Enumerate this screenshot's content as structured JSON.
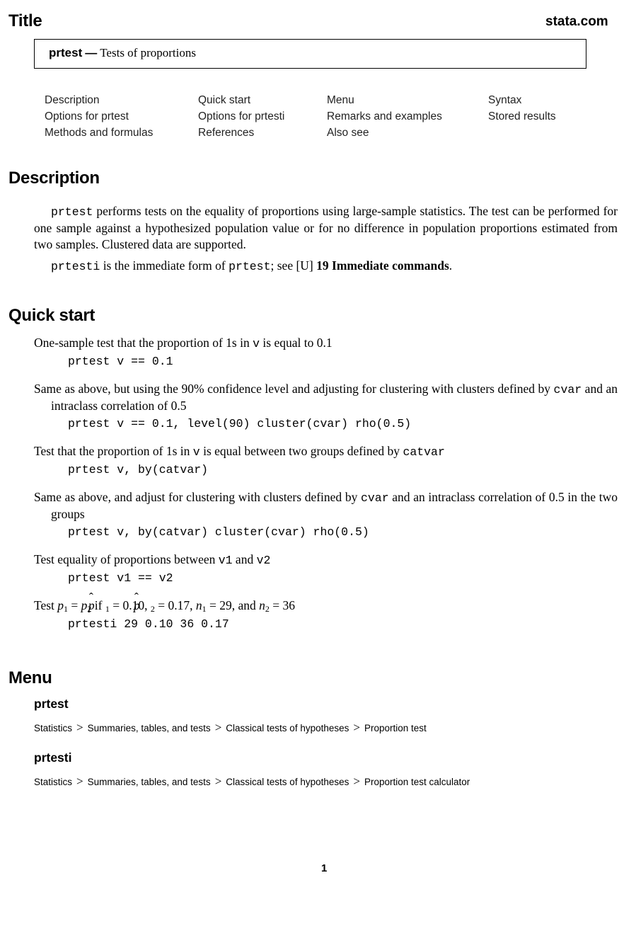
{
  "header": {
    "section_label": "Title",
    "brand": "stata.com"
  },
  "title_box": {
    "command": "prtest",
    "dash": "—",
    "description": "Tests of proportions"
  },
  "toc": {
    "columns": [
      [
        "Description",
        "Options for prtest",
        "Methods and formulas"
      ],
      [
        "Quick start",
        "Options for prtesti",
        "References"
      ],
      [
        "Menu",
        "Remarks and examples",
        "Also see"
      ],
      [
        "Syntax",
        "Stored results"
      ]
    ]
  },
  "description": {
    "heading": "Description",
    "p1": {
      "code": "prtest",
      "text": " performs tests on the equality of proportions using large-sample statistics. The test can be performed for one sample against a hypothesized population value or for no difference in population proportions estimated from two samples. Clustered data are supported."
    },
    "p2": {
      "code1": "prtesti",
      "text1": " is the immediate form of ",
      "code2": "prtest",
      "text2": "; see [U] ",
      "ref": "19 Immediate commands",
      "text3": "."
    }
  },
  "quick_start": {
    "heading": "Quick start",
    "items": [
      {
        "desc_parts": [
          "One-sample test that the proportion of 1s in ",
          "v",
          " is equal to 0.1"
        ],
        "command": "prtest v == 0.1"
      },
      {
        "desc_parts": [
          "Same as above, but using the 90% confidence level and adjusting for clustering with clusters defined by ",
          "cvar",
          " and an intraclass correlation of 0.5"
        ],
        "command": "prtest v == 0.1, level(90) cluster(cvar) rho(0.5)"
      },
      {
        "desc_parts": [
          "Test that the proportion of 1s in ",
          "v",
          " is equal between two groups defined by ",
          "catvar"
        ],
        "command": "prtest v, by(catvar)"
      },
      {
        "desc_parts": [
          "Same as above, and adjust for clustering with clusters defined by ",
          "cvar",
          " and an intraclass correlation of 0.5 in the two groups"
        ],
        "command": "prtest v, by(catvar) cluster(cvar) rho(0.5)"
      },
      {
        "desc_parts": [
          "Test equality of proportions between ",
          "v1",
          " and ",
          "v2"
        ],
        "command": "prtest v1 == v2"
      },
      {
        "desc_math": {
          "lead": "Test ",
          "p1": "p",
          "p1_sub": "1",
          "eq": " = ",
          "p2": "p",
          "p2_sub": "2",
          "if": " if ",
          "phat1_val": "0.10",
          "phat2_val": "0.17",
          "n1_val": "29",
          "n2_val": "36",
          "and": ", and "
        },
        "command": "prtesti 29 0.10 36 0.17"
      }
    ]
  },
  "menu": {
    "heading": "Menu",
    "entries": [
      {
        "command": "prtest",
        "path": [
          "Statistics",
          "Summaries, tables, and tests",
          "Classical tests of hypotheses",
          "Proportion test"
        ]
      },
      {
        "command": "prtesti",
        "path": [
          "Statistics",
          "Summaries, tables, and tests",
          "Classical tests of hypotheses",
          "Proportion test calculator"
        ]
      }
    ],
    "separator": ">"
  },
  "footer": {
    "page_number": "1"
  }
}
